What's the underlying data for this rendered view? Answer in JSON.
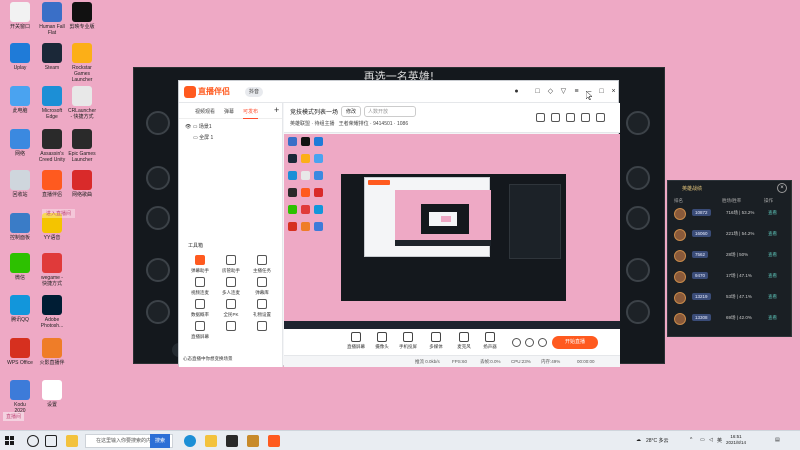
{
  "desktop": {
    "icons": [
      {
        "label": "开关窗口",
        "color": "#f2f2f2"
      },
      {
        "label": "Human Fall\nFlat",
        "color": "#3a6fc7"
      },
      {
        "label": "剪映专业版",
        "color": "#111111"
      },
      {
        "label": "Uplay",
        "color": "#1f7bd8"
      },
      {
        "label": "Steam",
        "color": "#1b2838"
      },
      {
        "label": "Rockstar\nGames\nLauncher",
        "color": "#fcaf17"
      },
      {
        "label": "此电脑",
        "color": "#4aa3f0"
      },
      {
        "label": "Microsoft\nEdge",
        "color": "#1c8fd6"
      },
      {
        "label": "CRLauncher\n- 快捷方式",
        "color": "#e8e8e8"
      },
      {
        "label": "网络",
        "color": "#3b89e0"
      },
      {
        "label": "Assassin's\nCreed Unity",
        "color": "#2a2a2a"
      },
      {
        "label": "Epic Games\nLauncher",
        "color": "#2a2a2a"
      },
      {
        "label": "回收站",
        "color": "#cfd6dd"
      },
      {
        "label": "直播伴侣",
        "color": "#ff5a1f"
      },
      {
        "label": "网络歌曲",
        "color": "#d92a2a"
      },
      {
        "label": "控制面板",
        "color": "#3a7cc7"
      },
      {
        "label": "YY语音",
        "color": "#f4c400"
      },
      {
        "label": "微信",
        "color": "#2dc100"
      },
      {
        "label": "wegame -\n快捷方式",
        "color": "#e03a3a"
      },
      {
        "label": "腾讯QQ",
        "color": "#1296db"
      },
      {
        "label": "Adobe\nPhotosh...",
        "color": "#001d34"
      },
      {
        "label": "WPS Office",
        "color": "#d6301f"
      },
      {
        "label": "火影直播伴",
        "color": "#ef7d28"
      },
      {
        "label": "Kodu\n2020",
        "color": "#3d7bd9"
      },
      {
        "label": "设置",
        "color": "#ffffff"
      }
    ],
    "floating_tag": "进入直播间",
    "bottom_tag": "直播间"
  },
  "game": {
    "title": "再选一名英雄!"
  },
  "app": {
    "logo": "直播伴侣",
    "version": "抖音",
    "left_tabs": [
      "视频观看",
      "弹幕",
      "可发布"
    ],
    "scenes": [
      "场景1",
      "全屏 1"
    ],
    "toolbox_title": "工具箱",
    "tools": [
      {
        "label": "弹幕助手",
        "hot": true
      },
      {
        "label": "房管助手",
        "hot": false
      },
      {
        "label": "主播任务",
        "hot": false
      },
      {
        "label": "视频连麦",
        "hot": false
      },
      {
        "label": "多人连麦",
        "hot": false
      },
      {
        "label": "弹幕库",
        "hot": false
      },
      {
        "label": "数据概率",
        "hot": false
      },
      {
        "label": "全民PK",
        "hot": false
      },
      {
        "label": "礼物设置",
        "hot": false
      },
      {
        "label": "直播屏幕",
        "hot": false
      },
      {
        "label": "",
        "hot": false
      },
      {
        "label": "",
        "hot": false
      }
    ],
    "bottom_tip": "心态直播中你想变换场景",
    "stream_title": "竞技模式列表一场",
    "modify": "修改",
    "announce_placeholder": "人数开放",
    "room_row": "英雄联盟 · 待组主播",
    "room_stats": "王者荣耀排位 · 9414501 · 1086",
    "controls": [
      {
        "label": "直播屏幕"
      },
      {
        "label": "摄像头"
      },
      {
        "label": "手机投屏"
      },
      {
        "label": "多媒体"
      },
      {
        "label": "麦克风"
      },
      {
        "label": "扬声器"
      }
    ],
    "start_button": "开始直播",
    "status": [
      "推流 0.0kb/s",
      "FPS:60",
      "丢帧:0.0%",
      "CPU:23%",
      "内存:49%",
      "00:00:00"
    ]
  },
  "rank_panel": {
    "title": "英雄战绩",
    "headers": [
      "排名",
      "胜场/胜率",
      "操作"
    ],
    "rows": [
      {
        "score": "10872",
        "rate": "716场 | 53.2%",
        "action": "查看"
      },
      {
        "score": "16060",
        "rate": "221场 | 54.2%",
        "action": "查看"
      },
      {
        "score": "7562",
        "rate": "28场 | 50%",
        "action": "查看"
      },
      {
        "score": "9470",
        "rate": "17场 | 47.1%",
        "action": "查看"
      },
      {
        "score": "13219",
        "rate": "53场 | 47.1%",
        "action": "查看"
      },
      {
        "score": "13308",
        "rate": "69场 | 42.0%",
        "action": "查看"
      }
    ]
  },
  "taskbar": {
    "search_placeholder": "在这里输入你要搜索的内容",
    "search_button": "搜索",
    "weather": "28°C 多云",
    "lang": "英",
    "time": "16:51",
    "date": "2021/8/14"
  }
}
